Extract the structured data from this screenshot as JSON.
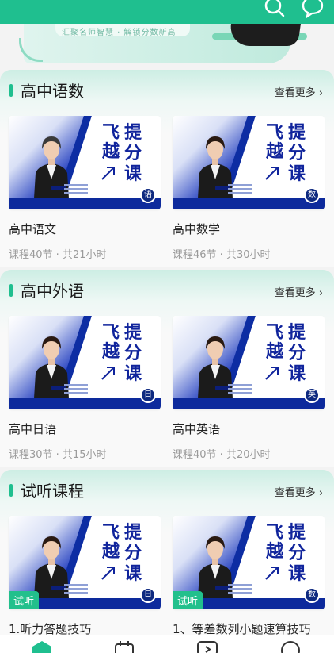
{
  "banner": {
    "text": "汇聚名师智慧 · 解锁分数新高"
  },
  "header": {
    "search_icon": "search-icon",
    "message_icon": "chat-icon",
    "accent": "#1fbf8f"
  },
  "sections": [
    {
      "title": "高中语数",
      "more": "查看更多 ›",
      "cards": [
        {
          "title": "高中语文",
          "meta": "课程40节 · 共21小时",
          "subject": "语",
          "tag": ""
        },
        {
          "title": "高中数学",
          "meta": "课程46节 · 共30小时",
          "subject": "数",
          "tag": ""
        }
      ]
    },
    {
      "title": "高中外语",
      "more": "查看更多 ›",
      "cards": [
        {
          "title": "高中日语",
          "meta": "课程30节 · 共15小时",
          "subject": "日",
          "tag": ""
        },
        {
          "title": "高中英语",
          "meta": "课程40节 · 共20小时",
          "subject": "英",
          "tag": ""
        }
      ]
    },
    {
      "title": "试听课程",
      "more": "查看更多 ›",
      "cards": [
        {
          "title": "1.听力答题技巧",
          "meta": "",
          "subject": "日",
          "tag": "试听"
        },
        {
          "title": "1、等差数列小题速算技巧",
          "meta": "",
          "subject": "数",
          "tag": "试听"
        }
      ]
    }
  ],
  "poster": {
    "line1": "飞",
    "line2": "越",
    "line3": "提",
    "line4": "分",
    "line5": "课"
  },
  "bottom_nav": [
    "home-icon",
    "calendar-icon",
    "play-icon",
    "profile-icon"
  ]
}
